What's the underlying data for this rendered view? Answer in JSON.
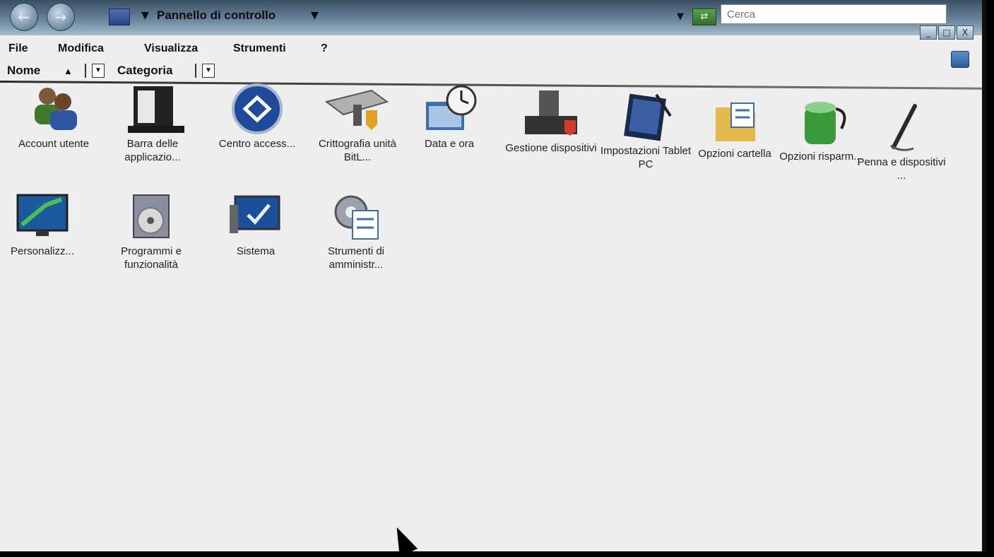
{
  "window": {
    "breadcrumb": "Pannello di controllo",
    "back_label": "back",
    "forward_label": "forward",
    "search_placeholder": "Cerca",
    "controls": [
      "_",
      "□",
      "X"
    ]
  },
  "menubar": {
    "items": [
      "File",
      "Modifica",
      "Visualizza",
      "Strumenti",
      "?"
    ]
  },
  "columns": {
    "name": "Nome",
    "category": "Categoria"
  },
  "items": [
    {
      "label": "Account utente",
      "icon": "user-accounts-icon"
    },
    {
      "label": "Barra delle applicazio...",
      "icon": "taskbar-icon"
    },
    {
      "label": "Centro access...",
      "icon": "ease-of-access-icon"
    },
    {
      "label": "Crittografia unità BitL...",
      "icon": "bitlocker-icon"
    },
    {
      "label": "Data e ora",
      "icon": "date-time-icon"
    },
    {
      "label": "Gestione dispositivi",
      "icon": "device-manager-icon"
    },
    {
      "label": "Impostazioni Tablet PC",
      "icon": "tablet-pc-icon"
    },
    {
      "label": "Opzioni cartella",
      "icon": "folder-options-icon"
    },
    {
      "label": "Opzioni risparm...",
      "icon": "power-options-icon"
    },
    {
      "label": "Penna e dispositivi ...",
      "icon": "pen-input-icon"
    },
    {
      "label": "Personalizz...",
      "icon": "personalization-icon"
    },
    {
      "label": "Programmi e funzionalità",
      "icon": "programs-features-icon"
    },
    {
      "label": "Sistema",
      "icon": "system-icon"
    },
    {
      "label": "Strumenti di amministr...",
      "icon": "admin-tools-icon"
    }
  ]
}
